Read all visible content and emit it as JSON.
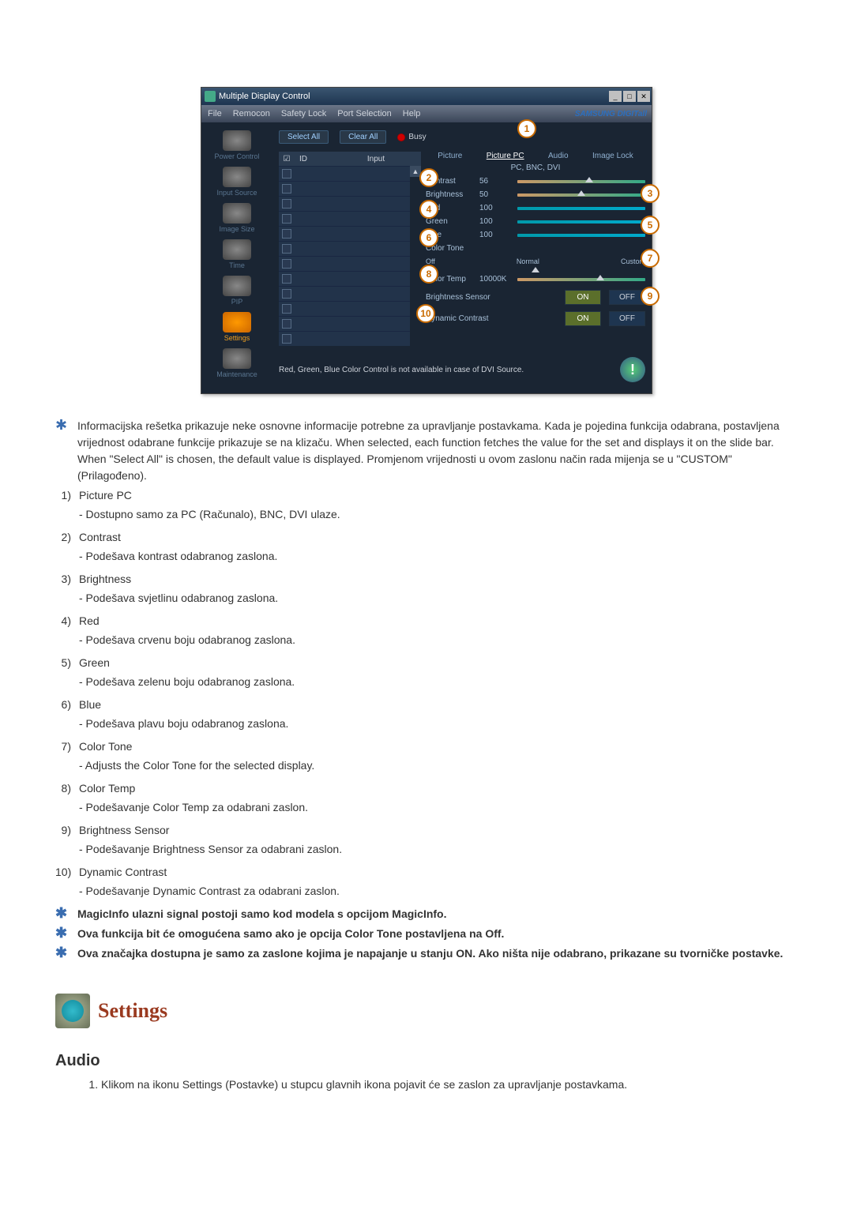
{
  "app": {
    "title": "Multiple Display Control",
    "brand": "SAMSUNG DIGITall"
  },
  "menubar": [
    "File",
    "Remocon",
    "Safety Lock",
    "Port Selection",
    "Help"
  ],
  "sidebar": [
    {
      "label": "Power Control"
    },
    {
      "label": "Input Source"
    },
    {
      "label": "Image Size"
    },
    {
      "label": "Time"
    },
    {
      "label": "PIP"
    },
    {
      "label": "Settings"
    },
    {
      "label": "Maintenance"
    }
  ],
  "toolbar": {
    "select_all": "Select All",
    "clear_all": "Clear All",
    "busy": "Busy"
  },
  "grid_headers": {
    "chk": "☑",
    "id": "ID",
    "status": "",
    "input": "Input"
  },
  "tabs": [
    "Picture",
    "Picture PC",
    "Audio",
    "Image Lock"
  ],
  "panel": {
    "subhead": "PC, BNC, DVI",
    "contrast": {
      "label": "Contrast",
      "value": "56"
    },
    "brightness": {
      "label": "Brightness",
      "value": "50"
    },
    "red": {
      "label": "Red",
      "value": "100"
    },
    "green": {
      "label": "Green",
      "value": "100"
    },
    "blue": {
      "label": "Blue",
      "value": "100"
    },
    "color_tone": {
      "label": "Color Tone",
      "opts": [
        "Off",
        "Normal",
        "Custom"
      ]
    },
    "color_temp": {
      "label": "Color Temp",
      "value": "10000K"
    },
    "bsensor": {
      "label": "Brightness Sensor",
      "on": "ON",
      "off": "OFF"
    },
    "dcontrast": {
      "label": "Dynamic Contrast",
      "on": "ON",
      "off": "OFF"
    }
  },
  "note_text": "Red, Green, Blue Color Control is not available in case of DVI Source.",
  "callouts": [
    "1",
    "2",
    "3",
    "4",
    "5",
    "6",
    "7",
    "8",
    "9",
    "10"
  ],
  "intro_star": "Informacijska rešetka prikazuje neke osnovne informacije potrebne za upravljanje postavkama. Kada je pojedina funkcija odabrana, postavljena vrijednost odabrane funkcije prikazuje se na klizaču. When selected, each function fetches the value for the set and displays it on the slide bar. When \"Select All\" is chosen, the default value is displayed. Promjenom vrijednosti u ovom zaslonu način rada mijenja se u \"CUSTOM\" (Prilagođeno).",
  "items": [
    {
      "n": "1)",
      "title": "Picture PC",
      "desc": "- Dostupno samo za PC (Računalo), BNC, DVI ulaze."
    },
    {
      "n": "2)",
      "title": "Contrast",
      "desc": "- Podešava kontrast odabranog zaslona."
    },
    {
      "n": "3)",
      "title": "Brightness",
      "desc": "- Podešava svjetlinu odabranog zaslona."
    },
    {
      "n": "4)",
      "title": "Red",
      "desc": "- Podešava crvenu boju odabranog zaslona."
    },
    {
      "n": "5)",
      "title": "Green",
      "desc": "- Podešava zelenu boju odabranog zaslona."
    },
    {
      "n": "6)",
      "title": "Blue",
      "desc": "- Podešava plavu boju odabranog zaslona."
    },
    {
      "n": "7)",
      "title": "Color Tone",
      "desc": "- Adjusts the Color Tone for the selected display."
    },
    {
      "n": "8)",
      "title": "Color Temp",
      "desc": "- Podešavanje Color Temp za odabrani zaslon."
    },
    {
      "n": "9)",
      "title": "Brightness Sensor",
      "desc": "- Podešavanje Brightness Sensor za odabrani zaslon."
    },
    {
      "n": "10)",
      "title": "Dynamic Contrast",
      "desc": "- Podešavanje Dynamic Contrast za odabrani zaslon."
    }
  ],
  "end_stars": [
    "MagicInfo ulazni signal postoji samo kod modela s opcijom MagicInfo.",
    "Ova funkcija bit će omogućena samo ako je opcija Color Tone postavljena na Off.",
    "Ova značajka dostupna je samo za zaslone kojima je napajanje u stanju ON. Ako ništa nije odabrano, prikazane su tvorničke postavke."
  ],
  "settings_title": "Settings",
  "audio_title": "Audio",
  "audio_item": "Klikom na ikonu Settings (Postavke) u stupcu glavnih ikona pojavit će se zaslon za upravljanje postavkama."
}
